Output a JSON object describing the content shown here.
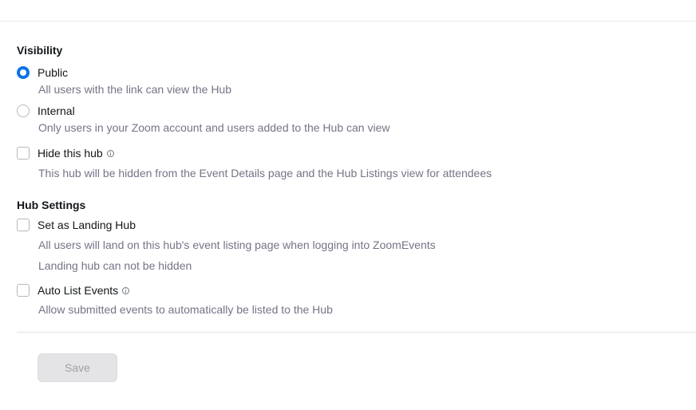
{
  "visibility": {
    "title": "Visibility",
    "public": {
      "label": "Public",
      "description": "All users with the link can view the Hub",
      "selected": true
    },
    "internal": {
      "label": "Internal",
      "description": "Only users in your Zoom account and users added to the Hub can view",
      "selected": false
    },
    "hide_hub": {
      "label": "Hide this hub",
      "description": "This hub will be hidden from the Event Details page and the Hub Listings view for attendees",
      "checked": false,
      "icon": "info-icon"
    }
  },
  "hub_settings": {
    "title": "Hub Settings",
    "landing_hub": {
      "label": "Set as Landing Hub",
      "description": "All users will land on this hub's event listing page when logging into ZoomEvents",
      "note": "Landing hub can not be hidden",
      "checked": false
    },
    "auto_list": {
      "label": "Auto List Events",
      "description": "Allow submitted events to automatically be listed to the Hub",
      "checked": false,
      "icon": "info-icon"
    }
  },
  "actions": {
    "save_label": "Save",
    "save_disabled": true
  },
  "colors": {
    "accent": "#0e71eb",
    "text_primary": "#131619",
    "text_secondary": "#747487",
    "button_disabled_bg": "#e4e4e6"
  }
}
